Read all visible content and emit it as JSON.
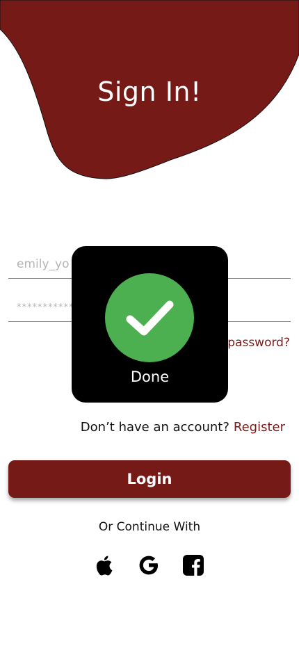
{
  "header": {
    "title": "Sign In!"
  },
  "form": {
    "email_value": "emily_yo",
    "password_masked": "***********",
    "forgot_label": "Forgot password?"
  },
  "register": {
    "prompt": "Don’t have an account?",
    "link_label": "Register"
  },
  "login_button": {
    "label": "Login"
  },
  "social": {
    "continue_label": "Or Continue With",
    "providers": [
      "apple-icon",
      "google-icon",
      "facebook-icon"
    ]
  },
  "overlay": {
    "status_label": "Done",
    "icon": "checkmark-icon"
  },
  "colors": {
    "brand": "#761a17",
    "success": "#4caf50",
    "overlay_bg": "#000000"
  }
}
